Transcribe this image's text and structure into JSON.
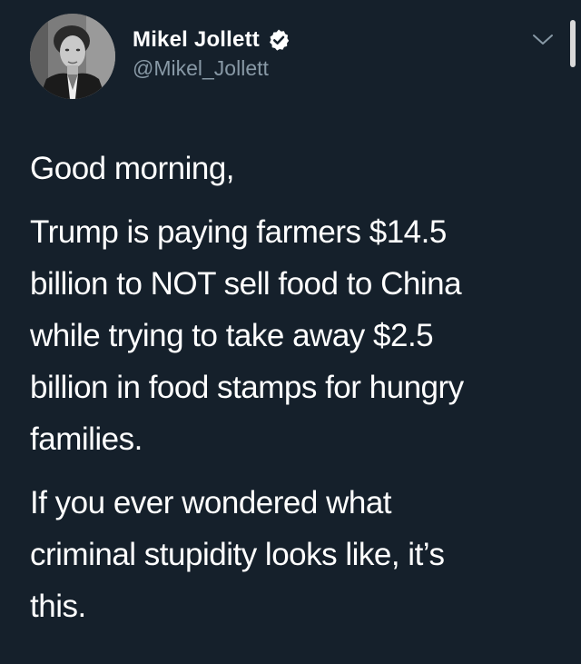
{
  "author": {
    "display_name": "Mikel Jollett",
    "handle": "@Mikel_Jollett",
    "verified": true
  },
  "icons": {
    "verified": "verified-badge-icon",
    "menu": "chevron-down-icon",
    "avatar": "profile-photo"
  },
  "tweet": {
    "paragraph_1": "Good morning,",
    "paragraph_2_lines": [
      "Trump is paying farmers $14.5",
      "billion to NOT sell food to China",
      "while trying to take away $2.5",
      "billion in food stamps for hungry",
      "families."
    ],
    "paragraph_3_lines": [
      "If you ever wondered what",
      "criminal stupidity looks like, it’s",
      "this."
    ]
  },
  "colors": {
    "background": "#15202b",
    "text": "#ffffff",
    "secondary_text": "#8899a6"
  }
}
